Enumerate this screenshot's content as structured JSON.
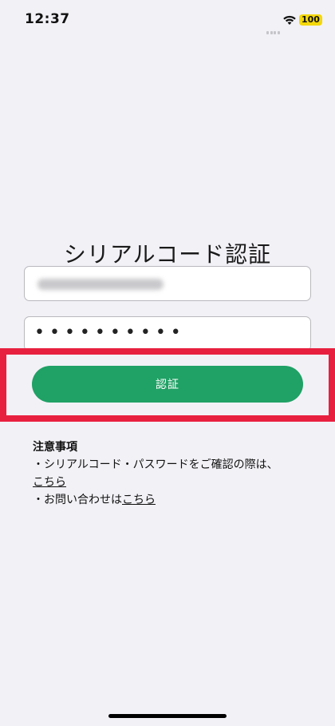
{
  "status_bar": {
    "time": "12:37",
    "battery": "100"
  },
  "page": {
    "title": "シリアルコード認証"
  },
  "form": {
    "serial_field_state": "blurred",
    "password_mask": "••••••••••",
    "submit_label": "認証"
  },
  "notes": {
    "title": "注意事項",
    "line1_prefix": "・シリアルコード・パスワードをご確認の際は、",
    "line1_link": "こちら",
    "line2_prefix": "・お問い合わせは",
    "line2_link": "こちら"
  },
  "colors": {
    "background": "#f2f1f6",
    "button": "#20a165",
    "highlight": "#e8203f",
    "battery": "#f4d80a"
  }
}
